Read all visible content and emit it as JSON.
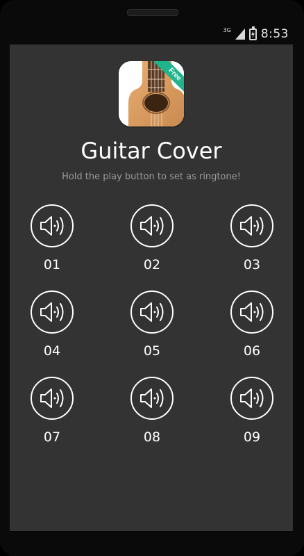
{
  "status_bar": {
    "network": "3G",
    "time": "8:53",
    "icons": [
      "signal-icon",
      "battery-charging-icon"
    ]
  },
  "app": {
    "icon_name": "guitar-app-icon",
    "badge": "Free",
    "title": "Guitar Cover",
    "subtitle": "Hold the play button to set as ringtone!"
  },
  "ringtones": [
    {
      "label": "01",
      "icon": "speaker-icon"
    },
    {
      "label": "02",
      "icon": "speaker-icon"
    },
    {
      "label": "03",
      "icon": "speaker-icon"
    },
    {
      "label": "04",
      "icon": "speaker-icon"
    },
    {
      "label": "05",
      "icon": "speaker-icon"
    },
    {
      "label": "06",
      "icon": "speaker-icon"
    },
    {
      "label": "07",
      "icon": "speaker-icon"
    },
    {
      "label": "08",
      "icon": "speaker-icon"
    },
    {
      "label": "09",
      "icon": "speaker-icon"
    }
  ],
  "colors": {
    "screen_bg": "#333333",
    "badge": "#1fb48c",
    "text": "#ffffff",
    "subtitle": "#9a9a9a"
  }
}
